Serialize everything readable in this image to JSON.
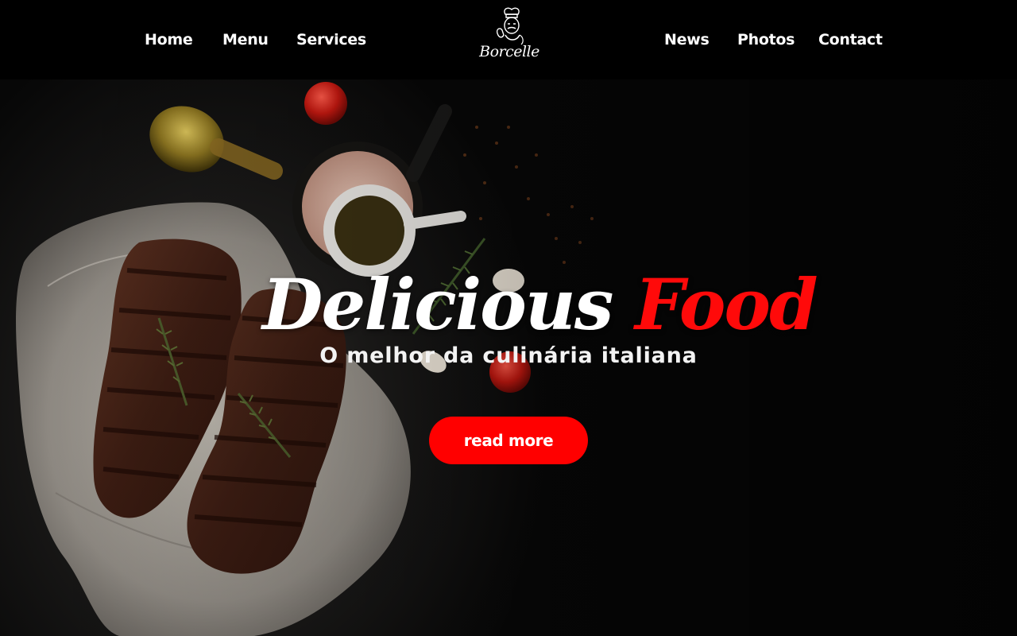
{
  "nav": {
    "left_items": [
      {
        "label": "Home"
      },
      {
        "label": "Menu"
      },
      {
        "label": "Services"
      }
    ],
    "right_items": [
      {
        "label": "News"
      },
      {
        "label": "Photos"
      },
      {
        "label": "Contact"
      }
    ]
  },
  "logo": {
    "text": "Borcelle",
    "icon": "chef-icon"
  },
  "hero": {
    "title_part1": "Delicious",
    "title_part2": "Food",
    "subtitle": "O melhor da culinária italiana",
    "cta_label": "read more"
  },
  "colors": {
    "accent": "#ff0000",
    "background": "#000000",
    "text": "#ffffff"
  }
}
